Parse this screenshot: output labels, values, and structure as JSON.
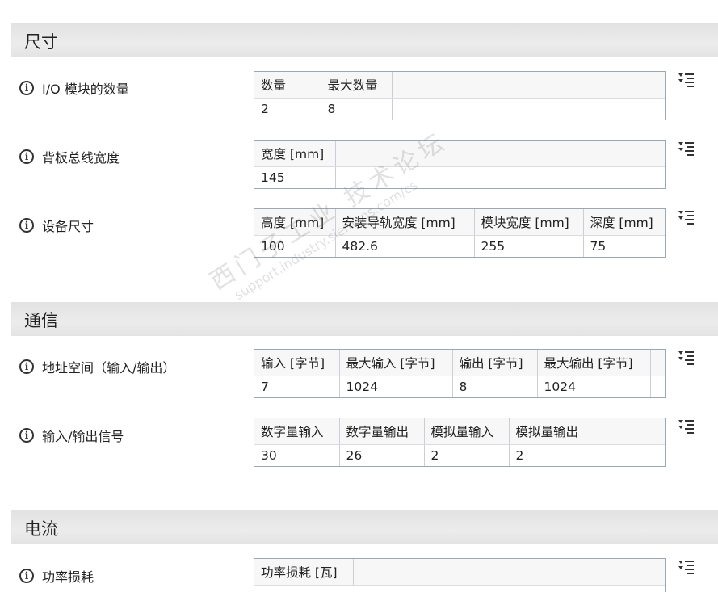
{
  "sections": {
    "size": {
      "title": "尺寸",
      "rows": {
        "io": {
          "label": "I/O 模块的数量",
          "headers": [
            "数量",
            "最大数量"
          ],
          "values": [
            "2",
            "8"
          ]
        },
        "backplane": {
          "label": "背板总线宽度",
          "headers": [
            "宽度 [mm]"
          ],
          "values": [
            "145"
          ]
        },
        "device": {
          "label": "设备尺寸",
          "headers": [
            "高度 [mm]",
            "安装导轨宽度 [mm]",
            "模块宽度 [mm]",
            "深度 [mm]"
          ],
          "values": [
            "100",
            "482.6",
            "255",
            "75"
          ]
        }
      }
    },
    "comm": {
      "title": "通信",
      "rows": {
        "address": {
          "label": "地址空间（输入/输出）",
          "headers": [
            "输入 [字节]",
            "最大输入 [字节]",
            "输出 [字节]",
            "最大输出 [字节]"
          ],
          "values": [
            "7",
            "1024",
            "8",
            "1024"
          ]
        },
        "signals": {
          "label": "输入/输出信号",
          "headers": [
            "数字量输入",
            "数字量输出",
            "模拟量输入",
            "模拟量输出"
          ],
          "values": [
            "30",
            "26",
            "2",
            "2"
          ]
        }
      }
    },
    "current": {
      "title": "电流",
      "rows": {
        "power": {
          "label": "功率损耗",
          "headers": [
            "功率损耗 [瓦]"
          ]
        }
      }
    }
  },
  "watermark": {
    "line1": "西门子工业 技术论坛",
    "line2": "support.industry.siemens.com/cs"
  },
  "colors": {
    "header_bg": "#e6e6e6",
    "grid_border": "#9aa8b4"
  },
  "icons": {
    "info": "info-icon",
    "column_menu": "column-options-icon"
  }
}
